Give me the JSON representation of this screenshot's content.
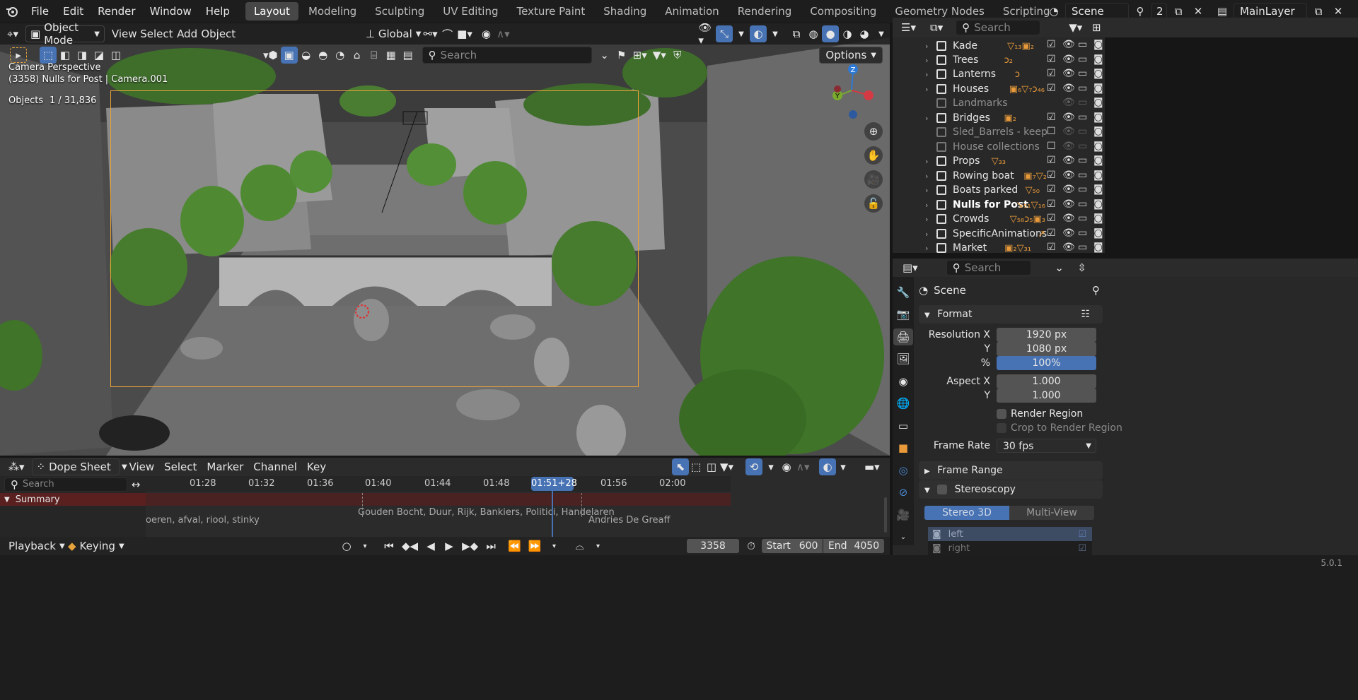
{
  "menubar": {
    "items": [
      "File",
      "Edit",
      "Render",
      "Window",
      "Help"
    ],
    "workspaces": [
      "Layout",
      "Modeling",
      "Sculpting",
      "UV Editing",
      "Texture Paint",
      "Shading",
      "Animation",
      "Rendering",
      "Compositing",
      "Geometry Nodes",
      "Scripting"
    ],
    "active_workspace": "Layout",
    "scene_name": "Scene",
    "scene_users": "2",
    "view_layer": "MainLayer"
  },
  "viewport": {
    "mode": "Object Mode",
    "menus": [
      "View",
      "Select",
      "Add",
      "Object"
    ],
    "transform_orientation": "Global",
    "search_placeholder": "Search",
    "options_label": "Options",
    "camera_label": "Camera Perspective",
    "frame_info": "(3358) Nulls for Post | Camera.001",
    "objects_label": "Objects",
    "objects_count": "1 / 31,836"
  },
  "outliner": {
    "search_placeholder": "Search",
    "rows": [
      {
        "name": "Kade",
        "icons": "▽₁₃▣₂",
        "state": "normal"
      },
      {
        "name": "Trees",
        "icons": "ↄ₂",
        "state": "normal"
      },
      {
        "name": "Lanterns",
        "icons": "ↄ",
        "state": "normal"
      },
      {
        "name": "Houses",
        "icons": "▣₆▽₇ↄ₄₆",
        "state": "normal"
      },
      {
        "name": "Landmarks",
        "icons": "",
        "state": "dim"
      },
      {
        "name": "Bridges",
        "icons": "▣₂",
        "state": "normal"
      },
      {
        "name": "Sled_Barrels - keep disa",
        "icons": "",
        "state": "dim"
      },
      {
        "name": "House collections - kee",
        "icons": "",
        "state": "dim"
      },
      {
        "name": "Props",
        "icons": "▽₃₃",
        "state": "normal"
      },
      {
        "name": "Rowing boat",
        "icons": "▣₇▽₂",
        "state": "normal"
      },
      {
        "name": "Boats parked",
        "icons": "▽₅₀",
        "state": "normal"
      },
      {
        "name": "Nulls for Post",
        "icons": "↘₅₁▽₁₆",
        "state": "bold"
      },
      {
        "name": "Crowds",
        "icons": "▽₅₈ↄ₅▣₃",
        "state": "normal"
      },
      {
        "name": "SpecificAnimations",
        "icons": "↗",
        "state": "normal"
      },
      {
        "name": "Market",
        "icons": "▣₂▽₃₁",
        "state": "normal"
      }
    ]
  },
  "properties": {
    "search_placeholder": "Search",
    "context": "Scene",
    "format_title": "Format",
    "resolution_x_label": "Resolution X",
    "resolution_x": "1920 px",
    "y_label": "Y",
    "resolution_y": "1080 px",
    "pct_label": "%",
    "resolution_pct": "100%",
    "aspect_x_label": "Aspect X",
    "aspect_x": "1.000",
    "aspect_y": "1.000",
    "render_region": "Render Region",
    "crop_region": "Crop to Render Region",
    "frame_rate_label": "Frame Rate",
    "frame_rate": "30 fps",
    "frame_range_title": "Frame Range",
    "stereoscopy_title": "Stereoscopy",
    "stereo_3d": "Stereo 3D",
    "multi_view": "Multi-View",
    "view_left": "left",
    "view_right": "right"
  },
  "dopesheet": {
    "mode": "Dope Sheet",
    "menus": [
      "View",
      "Select",
      "Marker",
      "Channel",
      "Key"
    ],
    "search_placeholder": "Search",
    "time_labels": [
      "01:28",
      "01:32",
      "01:36",
      "01:40",
      "01:44",
      "01:48",
      "01:51+28",
      "01:56",
      "02:00"
    ],
    "current_time": "01:51+28",
    "summary_label": "Summary",
    "marker_left": "oeren, afval, riool, stinky",
    "marker_mid": "Gouden Bocht, Duur, Rijk, Bankiers, Politici, Handelaren",
    "marker_right": "Andries De Greaff"
  },
  "timeline": {
    "playback": "Playback",
    "keying": "Keying",
    "current_frame": "3358",
    "start_label": "Start",
    "start_value": "600",
    "end_label": "End",
    "end_value": "4050"
  },
  "status": {
    "version": "5.0.1"
  }
}
